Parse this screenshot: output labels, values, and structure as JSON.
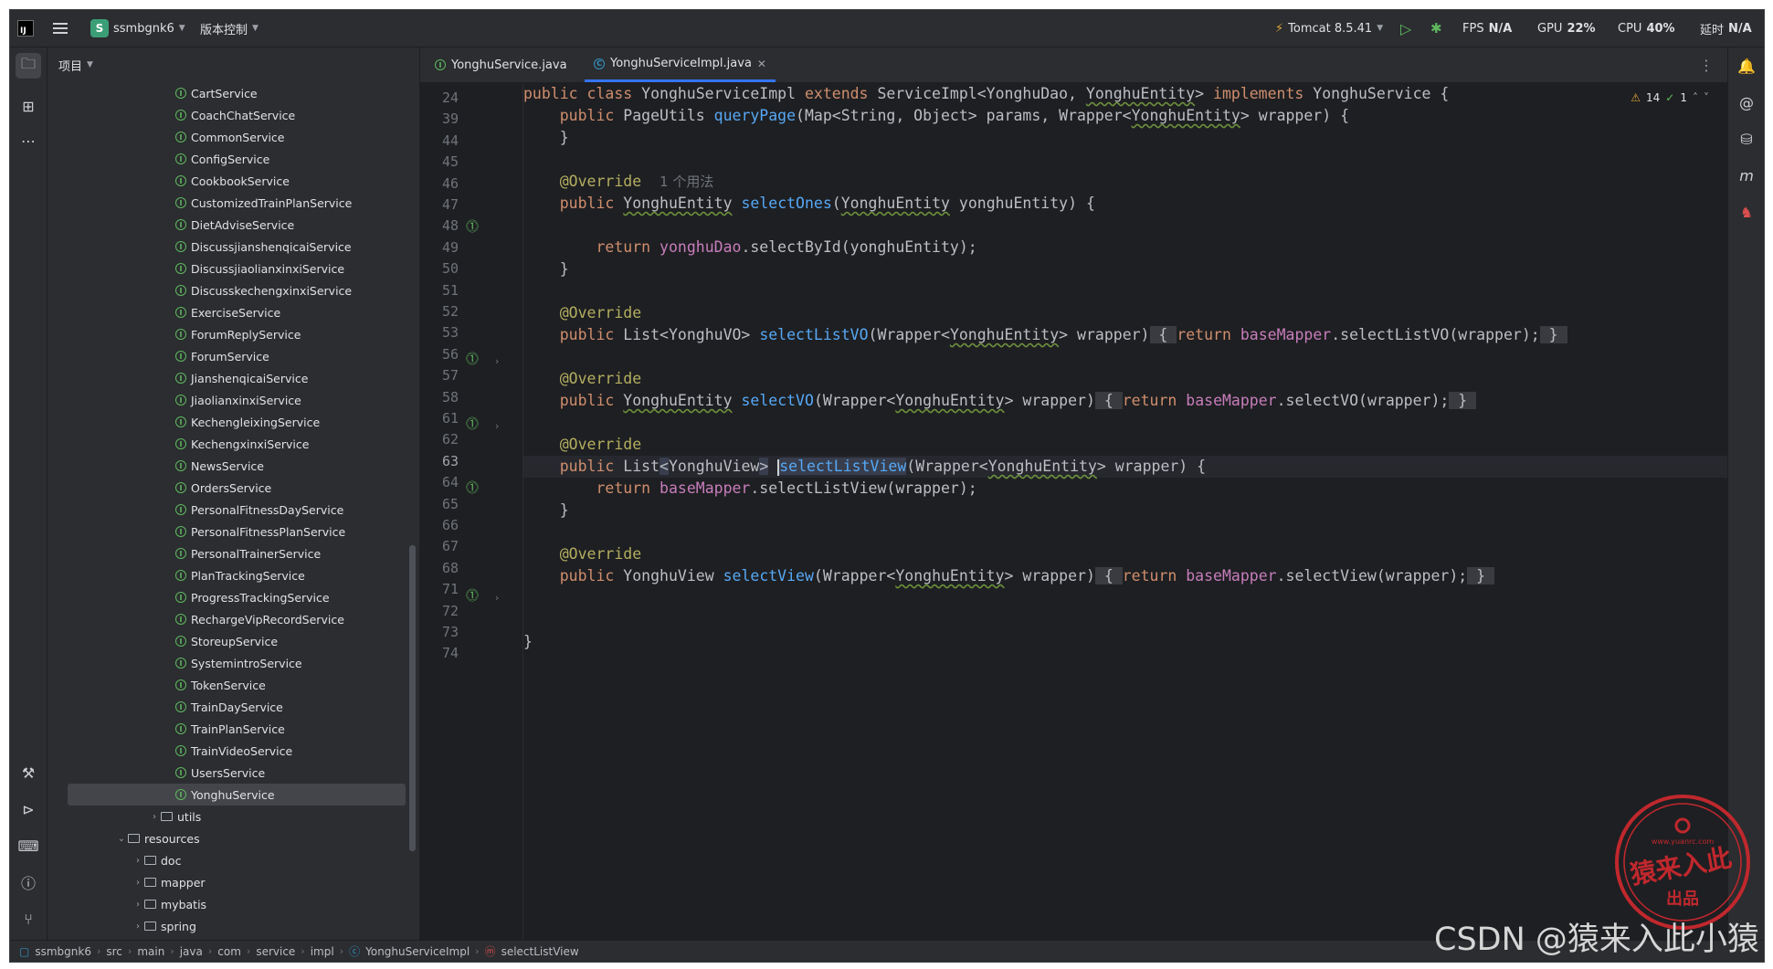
{
  "titlebar": {
    "project_badge": "S",
    "project_name": "ssmbgnk6",
    "vcs_label": "版本控制",
    "run_config": "Tomcat 8.5.41",
    "fps_label": "FPS",
    "fps_value": "N/A",
    "gpu_label": "GPU",
    "gpu_value": "22%",
    "cpu_label": "CPU",
    "cpu_value": "40%",
    "latency_label": "延时",
    "latency_value": "N/A"
  },
  "project_panel": {
    "title": "项目",
    "services": [
      "CartService",
      "CoachChatService",
      "CommonService",
      "ConfigService",
      "CookbookService",
      "CustomizedTrainPlanService",
      "DietAdviseService",
      "DiscussjianshenqicaiService",
      "DiscussjiaolianxinxiService",
      "DiscusskechengxinxiService",
      "ExerciseService",
      "ForumReplyService",
      "ForumService",
      "JianshenqicaiService",
      "JiaolianxinxiService",
      "KechengleixingService",
      "KechengxinxiService",
      "NewsService",
      "OrdersService",
      "PersonalFitnessDayService",
      "PersonalFitnessPlanService",
      "PersonalTrainerService",
      "PlanTrackingService",
      "ProgressTrackingService",
      "RechargeVipRecordService",
      "StoreupService",
      "SystemintroService",
      "TokenService",
      "TrainDayService",
      "TrainPlanService",
      "TrainVideoService",
      "UsersService",
      "YonghuService"
    ],
    "selected": "YonghuService",
    "folders": {
      "utils": "utils",
      "resources": "resources",
      "doc": "doc",
      "mapper": "mapper",
      "mybatis": "mybatis",
      "spring": "spring"
    }
  },
  "tabs": [
    {
      "label": "YonghuService.java"
    },
    {
      "label": "YonghuServiceImpl.java"
    }
  ],
  "editor": {
    "line_numbers": [
      "24",
      "39",
      "44",
      "45",
      "46",
      "47",
      "48",
      "49",
      "50",
      "51",
      "52",
      "53",
      "56",
      "57",
      "58",
      "61",
      "62",
      "63",
      "64",
      "65",
      "66",
      "67",
      "68",
      "71",
      "72",
      "73",
      "74"
    ],
    "usage_hint": "1 个用法",
    "warnings_count": "14",
    "ok_count": "1"
  },
  "breadcrumb": [
    "ssmbgnk6",
    "src",
    "main",
    "java",
    "com",
    "service",
    "impl",
    "YonghuServiceImpl",
    "selectListView"
  ],
  "watermark": {
    "csdn": "CSDN @猿来入此小猿",
    "stamp_main": "猿来入此",
    "stamp_sub": "出品",
    "stamp_url": "www.yuanrc.com"
  },
  "colors": {
    "background": "#1e1f22",
    "panel": "#2b2d30",
    "keyword": "#cf8e6d",
    "function": "#56a8f5",
    "annotation": "#b3ae60",
    "field": "#c77dbb",
    "accent": "#3574f0",
    "interface_icon": "#5fb85f",
    "stamp_red": "#c0282d"
  }
}
